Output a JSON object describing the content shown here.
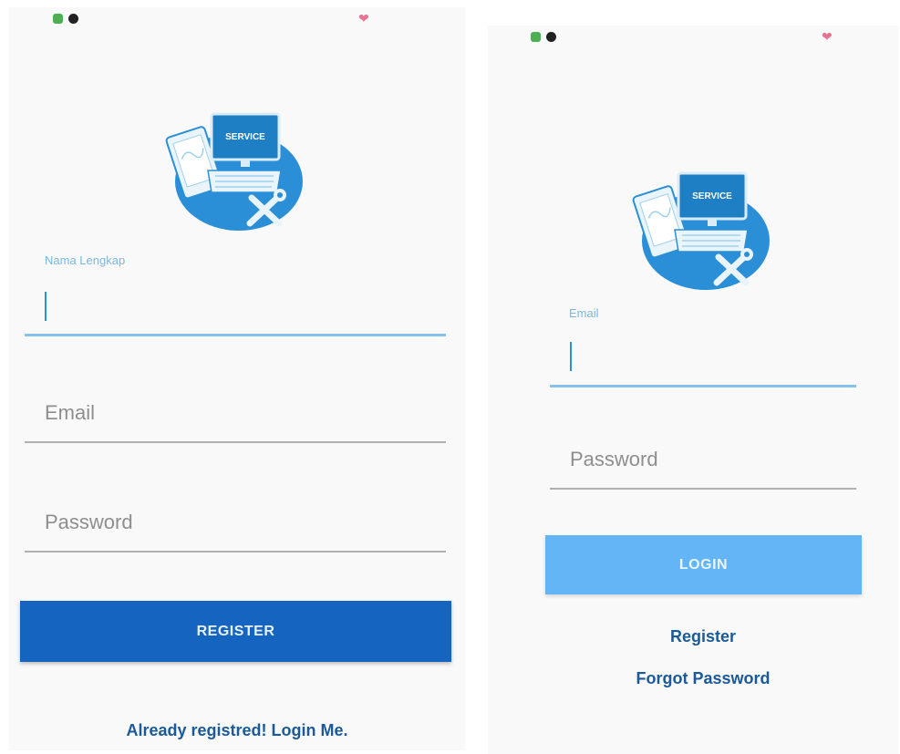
{
  "colors": {
    "primary": "#1565c0",
    "login_button": "#64b5f6",
    "accent_label": "#7bb8e0",
    "link": "#1a5a9a",
    "logo_blue": "#2a8fd6"
  },
  "status_bar": {
    "icons": [
      "app-notification-icon",
      "app-notification-icon",
      "heart-icon"
    ]
  },
  "register_screen": {
    "logo_text": "SERVICE",
    "name_label": "Nama Lengkap",
    "name_value": "",
    "email_placeholder": "Email",
    "password_placeholder": "Password",
    "register_button": "REGISTER",
    "login_link": "Already registred! Login Me."
  },
  "login_screen": {
    "logo_text": "SERVICE",
    "email_label": "Email",
    "email_value": "",
    "password_placeholder": "Password",
    "login_button": "LOGIN",
    "register_link": "Register",
    "forgot_link": "Forgot Password"
  }
}
